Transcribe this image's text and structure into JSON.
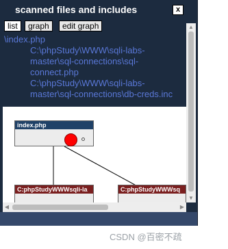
{
  "window": {
    "title": "scanned files and includes",
    "close_label": "x"
  },
  "tabs": [
    {
      "label": "list"
    },
    {
      "label": "graph"
    },
    {
      "label": "edit graph"
    }
  ],
  "list": {
    "main_file": "\\index.php",
    "includes": [
      "C:\\phpStudy\\WWW\\sqli-labs-master\\sql-connections\\sql-connect.php",
      "C:\\phpStudy\\WWW\\sqli-labs-master\\sql-connections\\db-creds.inc"
    ]
  },
  "graph": {
    "nodes": [
      {
        "label": "index.php"
      },
      {
        "label": "C:phpStudyWWWsqli-la"
      },
      {
        "label": "C:phpStudyWWWsq"
      }
    ]
  },
  "watermark": "CSDN @百密不疏",
  "colors": {
    "window_bg": "#1c2b3f",
    "link_text": "#5a78d8",
    "node_header_main": "#1f4167",
    "node_header_include": "#7a1f1f",
    "node_marker": "#ff0000"
  }
}
